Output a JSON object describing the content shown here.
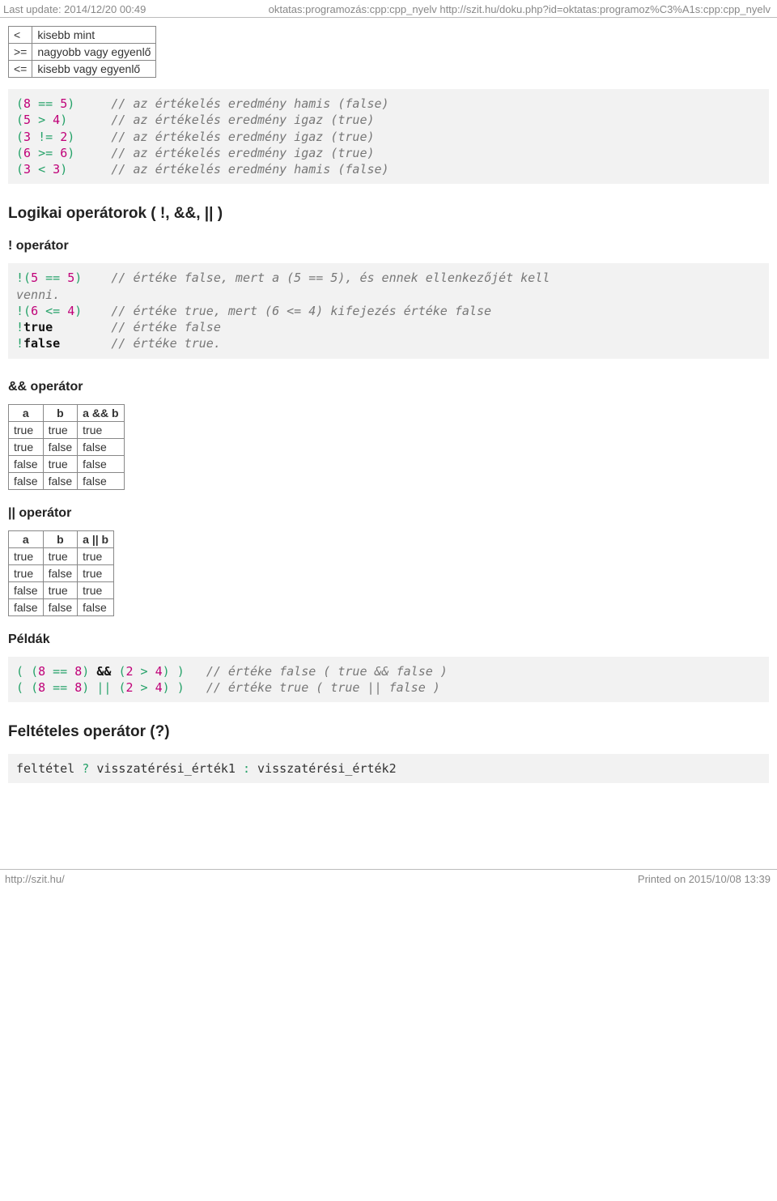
{
  "header": {
    "left": "Last update: 2014/12/20 00:49",
    "center": "oktatas:programozás:cpp:cpp_nyelv http://szit.hu/doku.php?id=oktatas:programoz%C3%A1s:cpp:cpp_nyelv"
  },
  "op_table": {
    "rows": [
      {
        "op": "<",
        "desc": "kisebb mint"
      },
      {
        "op": ">=",
        "desc": "nagyobb vagy egyenlő"
      },
      {
        "op": "<=",
        "desc": "kisebb vagy egyenlő"
      }
    ]
  },
  "code1": {
    "l1_expr": "(8 == 5)",
    "l1_cm": "// az értékelés eredmény hamis (false)",
    "l2_expr": "(5 > 4)",
    "l2_cm": "// az értékelés eredmény igaz (true)",
    "l3_expr": "(3 != 2)",
    "l3_cm": "// az értékelés eredmény igaz (true)",
    "l4_expr": "(6 >= 6)",
    "l4_cm": "// az értékelés eredmény igaz (true)",
    "l5_expr": "(3 < 3)",
    "l5_cm": "// az értékelés eredmény hamis (false)"
  },
  "h_logical": "Logikai operátorok ( !, &&, || )",
  "h_not": "! operátor",
  "code2": {
    "l1a": "!(5 == 5)",
    "l1b": "// értéke false, mert a (5 == 5), és ennek ellenkezőjét kell",
    "l1c": "venni.",
    "l2a": "!(6 <= 4)",
    "l2b": "// értéke true, mert (6 <= 4) kifejezés értéke false",
    "l3a": "!true",
    "l3b": "// értéke false",
    "l4a": "!false",
    "l4b": "// értéke true."
  },
  "h_and": "&& operátor",
  "and_table": {
    "head": [
      "a",
      "b",
      "a && b"
    ],
    "rows": [
      [
        "true",
        "true",
        "true"
      ],
      [
        "true",
        "false",
        "false"
      ],
      [
        "false",
        "true",
        "false"
      ],
      [
        "false",
        "false",
        "false"
      ]
    ]
  },
  "h_or": "|| operátor",
  "or_table": {
    "head": [
      "a",
      "b",
      "a || b"
    ],
    "rows": [
      [
        "true",
        "true",
        "true"
      ],
      [
        "true",
        "false",
        "true"
      ],
      [
        "false",
        "true",
        "true"
      ],
      [
        "false",
        "false",
        "false"
      ]
    ]
  },
  "h_peldak": "Példák",
  "code3": {
    "l1": "( (8 == 8) && (2 > 4) )   // értéke false ( true && false )",
    "l2": "( (8 == 8) || (2 > 4) )   // értéke true ( true || false )"
  },
  "h_cond": "Feltételes operátor (?)",
  "code4": {
    "text": "feltétel ? visszatérési_érték1 : visszatérési_érték2"
  },
  "footer": {
    "left": "http://szit.hu/",
    "right": "Printed on 2015/10/08 13:39"
  },
  "chart_data": {
    "type": "table",
    "tables": [
      {
        "title": "&& operátor",
        "columns": [
          "a",
          "b",
          "a && b"
        ],
        "rows": [
          [
            "true",
            "true",
            "true"
          ],
          [
            "true",
            "false",
            "false"
          ],
          [
            "false",
            "true",
            "false"
          ],
          [
            "false",
            "false",
            "false"
          ]
        ]
      },
      {
        "title": "|| operátor",
        "columns": [
          "a",
          "b",
          "a || b"
        ],
        "rows": [
          [
            "true",
            "true",
            "true"
          ],
          [
            "true",
            "false",
            "true"
          ],
          [
            "false",
            "true",
            "true"
          ],
          [
            "false",
            "false",
            "false"
          ]
        ]
      }
    ]
  }
}
